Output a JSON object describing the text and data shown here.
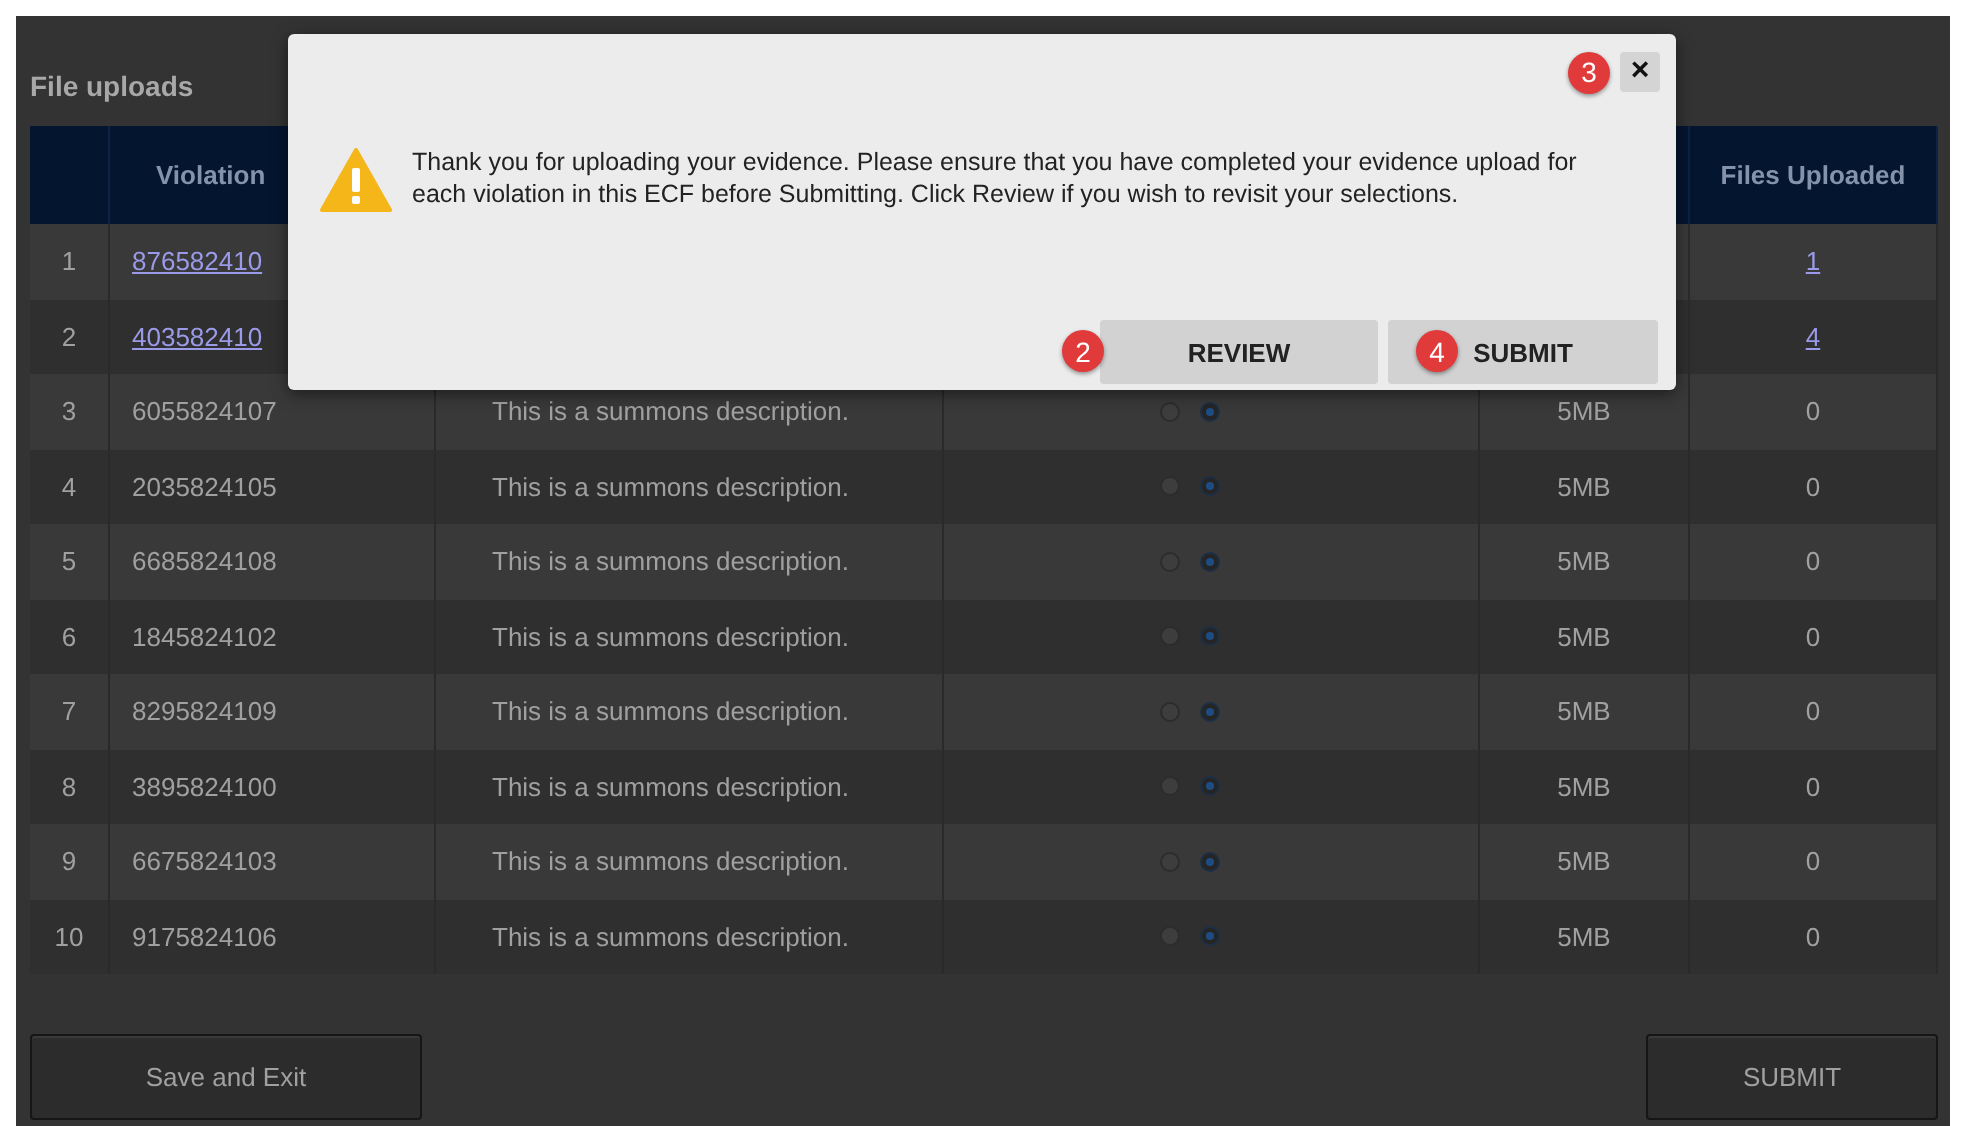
{
  "page": {
    "title": "File uploads"
  },
  "table": {
    "columns": [
      {},
      {
        "label": "Violation"
      },
      {},
      {},
      {},
      {
        "label": "Files Uploaded"
      }
    ],
    "rows": [
      {
        "number": "1",
        "violation": "876582410",
        "violation_link": true,
        "files": "1",
        "files_link": true
      },
      {
        "number": "2",
        "violation": "403582410",
        "violation_link": true,
        "files": "4",
        "files_link": true
      },
      {
        "number": "3",
        "violation": "6055824107",
        "violation_link": false,
        "description": "This is a summons description.",
        "radios": [
          {
            "selected": false
          },
          {
            "selected": true
          }
        ],
        "size": "5MB",
        "files": "0",
        "files_link": false
      },
      {
        "number": "4",
        "violation": "2035824105",
        "violation_link": false,
        "description": "This is a summons description.",
        "radios": [
          {
            "selected": false
          },
          {
            "selected": true
          }
        ],
        "size": "5MB",
        "files": "0",
        "files_link": false
      },
      {
        "number": "5",
        "violation": "6685824108",
        "violation_link": false,
        "description": "This is a summons description.",
        "radios": [
          {
            "selected": false
          },
          {
            "selected": true
          }
        ],
        "size": "5MB",
        "files": "0",
        "files_link": false
      },
      {
        "number": "6",
        "violation": "1845824102",
        "violation_link": false,
        "description": "This is a summons description.",
        "radios": [
          {
            "selected": false
          },
          {
            "selected": true
          }
        ],
        "size": "5MB",
        "files": "0",
        "files_link": false
      },
      {
        "number": "7",
        "violation": "8295824109",
        "violation_link": false,
        "description": "This is a summons description.",
        "radios": [
          {
            "selected": false
          },
          {
            "selected": true
          }
        ],
        "size": "5MB",
        "files": "0",
        "files_link": false
      },
      {
        "number": "8",
        "violation": "3895824100",
        "violation_link": false,
        "description": "This is a summons description.",
        "radios": [
          {
            "selected": false
          },
          {
            "selected": true
          }
        ],
        "size": "5MB",
        "files": "0",
        "files_link": false
      },
      {
        "number": "9",
        "violation": "6675824103",
        "violation_link": false,
        "description": "This is a summons description.",
        "radios": [
          {
            "selected": false
          },
          {
            "selected": true
          }
        ],
        "size": "5MB",
        "files": "0",
        "files_link": false
      },
      {
        "number": "10",
        "violation": "9175824106",
        "violation_link": false,
        "description": "This is a summons description.",
        "radios": [
          {
            "selected": false
          },
          {
            "selected": true
          }
        ],
        "size": "5MB",
        "files": "0",
        "files_link": false
      }
    ]
  },
  "buttons": {
    "save": "Save and Exit",
    "submit": "SUBMIT"
  },
  "dialog": {
    "message": "Thank you for uploading your evidence. Please ensure that you have completed your evidence upload for each violation in this ECF before Submitting. Click Review if you wish to revisit your selections.",
    "close": {
      "label": "×",
      "badge": "3"
    },
    "buttons": [
      {
        "label": "REVIEW",
        "badge": "2"
      },
      {
        "label": "SUBMIT",
        "badge": "4"
      }
    ]
  }
}
